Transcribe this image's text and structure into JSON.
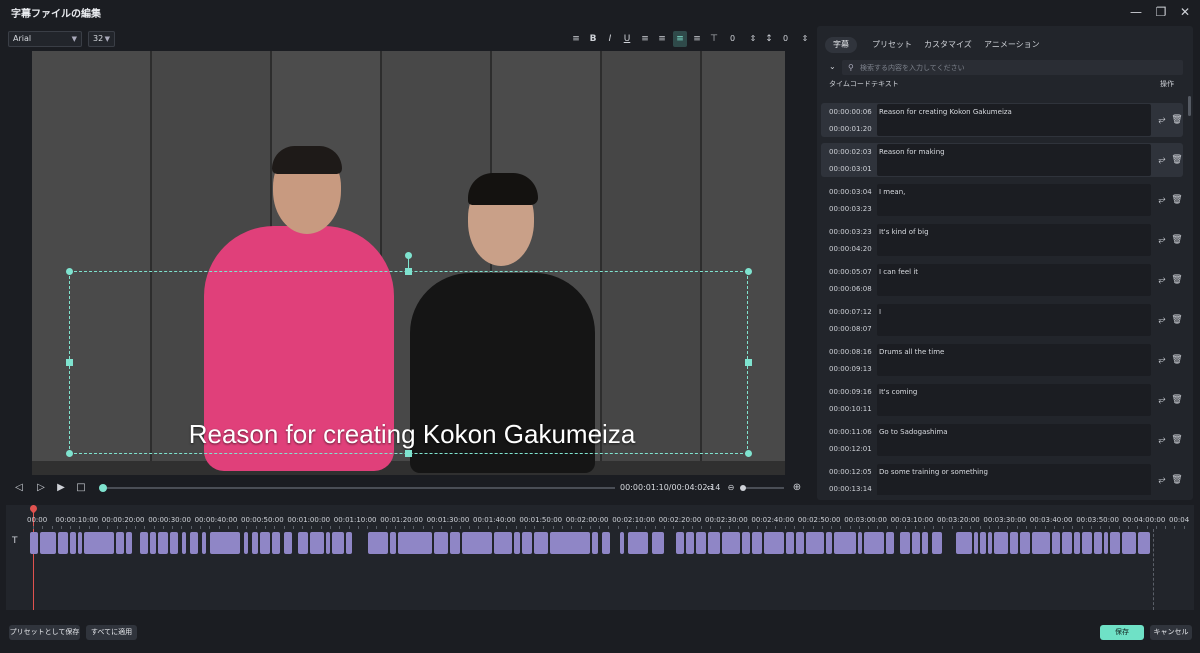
{
  "window": {
    "title": "字幕ファイルの編集",
    "controls": [
      "minimize-icon",
      "restore-icon",
      "close-icon"
    ]
  },
  "toolbar": {
    "font": "Arial",
    "size": "32",
    "letter_spacing": "0",
    "line_spacing": "0",
    "format_icons": [
      "text-spacing-icon",
      "bold-icon",
      "italic-icon",
      "underline-icon",
      "align-left-icon",
      "align-center-icon",
      "align-justify-icon",
      "align-right-icon",
      "align-top-icon"
    ]
  },
  "preview": {
    "subtitle": "Reason for creating Kokon Gakumeiza"
  },
  "player": {
    "current_time": "00:00:01:10",
    "total_time": "00:04:02:14",
    "timecode": "00:00:01:10/00:04:02:14",
    "progress": 0.006
  },
  "panel": {
    "tabs": [
      "字幕",
      "プリセット",
      "カスタマイズ",
      "アニメーション"
    ],
    "active_tab": 0,
    "search_placeholder": "検索する内容を入力してください",
    "columns": {
      "timecode": "タイムコード",
      "text": "テキスト",
      "action": "操作"
    },
    "rows": [
      {
        "start": "00:00:00:06",
        "end": "00:00:01:20",
        "text": "Reason for creating Kokon Gakumeiza",
        "selected": true
      },
      {
        "start": "00:00:02:03",
        "end": "00:00:03:01",
        "text": "Reason for making",
        "selected": false
      },
      {
        "start": "00:00:03:04",
        "end": "00:00:03:23",
        "text": "I mean,",
        "selected": false
      },
      {
        "start": "00:00:03:23",
        "end": "00:00:04:20",
        "text": "It's kind of big",
        "selected": false
      },
      {
        "start": "00:00:05:07",
        "end": "00:00:06:08",
        "text": "I can feel it",
        "selected": false
      },
      {
        "start": "00:00:07:12",
        "end": "00:00:08:07",
        "text": "I",
        "selected": false
      },
      {
        "start": "00:00:08:16",
        "end": "00:00:09:13",
        "text": "Drums all the time",
        "selected": false
      },
      {
        "start": "00:00:09:16",
        "end": "00:00:10:11",
        "text": "It's coming",
        "selected": false
      },
      {
        "start": "00:00:11:06",
        "end": "00:00:12:01",
        "text": "Go to Sadogashima",
        "selected": false
      },
      {
        "start": "00:00:12:05",
        "end": "00:00:13:14",
        "text": "Do some training or something",
        "selected": false
      }
    ]
  },
  "timeline": {
    "ruler": [
      "00:00",
      "00:00:10:00",
      "00:00:20:00",
      "00:00:30:00",
      "00:00:40:00",
      "00:00:50:00",
      "00:01:00:00",
      "00:01:10:00",
      "00:01:20:00",
      "00:01:30:00",
      "00:01:40:00",
      "00:01:50:00",
      "00:02:00:00",
      "00:02:10:00",
      "00:02:20:00",
      "00:02:30:00",
      "00:02:40:00",
      "00:02:50:00",
      "00:03:00:00",
      "00:03:10:00",
      "00:03:20:00",
      "00:03:30:00",
      "00:03:40:00",
      "00:03:50:00",
      "00:04:00:00",
      "00:04"
    ],
    "clip_color": "#8f86c6",
    "playhead_color": "#e0524f"
  },
  "footer": {
    "save_as_preset": "プリセットとして保存",
    "apply_all": "すべてに適用",
    "save": "保存",
    "cancel": "キャンセル"
  },
  "colors": {
    "accent": "#6fe1c6",
    "background": "#1b1d22",
    "panel": "#22252b"
  }
}
